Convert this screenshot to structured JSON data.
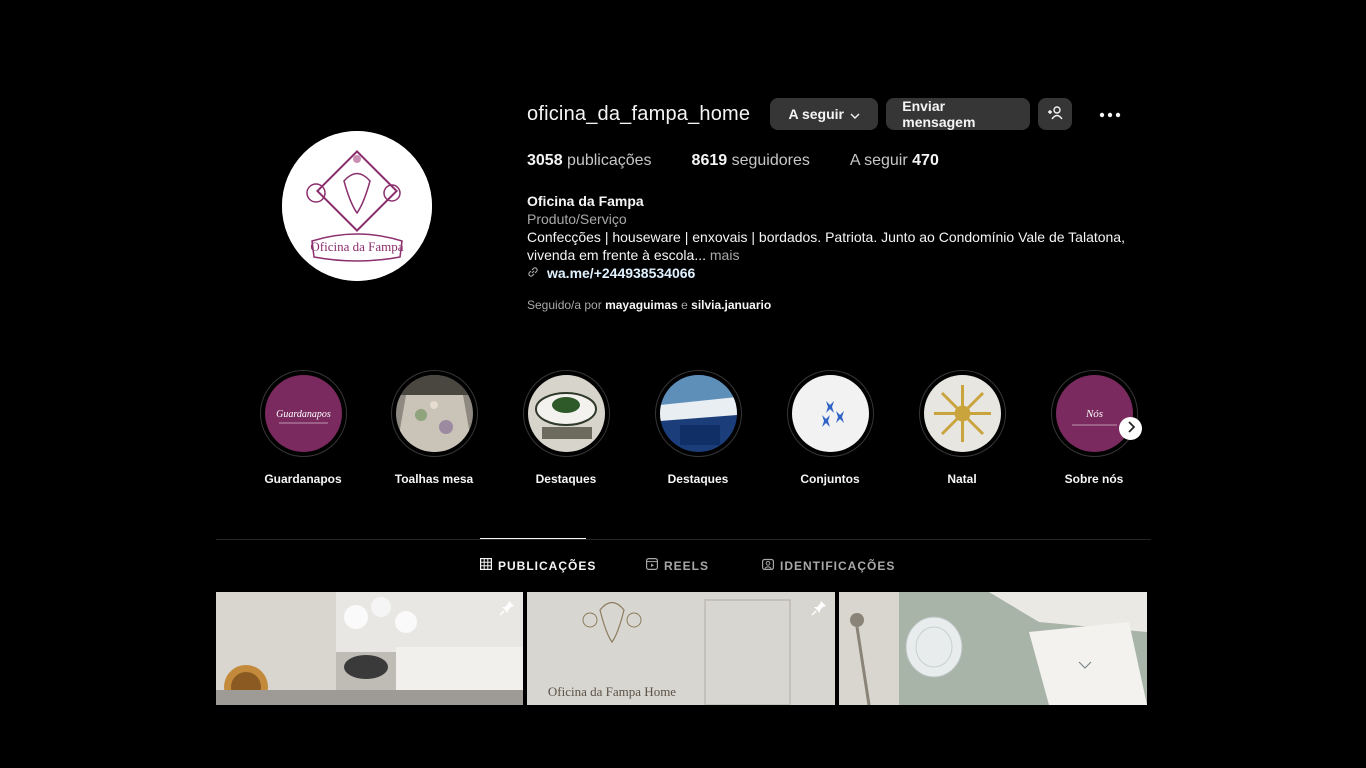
{
  "profile": {
    "username": "oficina_da_fampa_home",
    "follow_button": "A seguir",
    "message_button": "Enviar mensagem",
    "stats": {
      "posts_count": "3058",
      "posts_label": "publicações",
      "followers_count": "8619",
      "followers_label": "seguidores",
      "following_label": "A seguir",
      "following_count": "470"
    },
    "bio": {
      "name": "Oficina da Fampa",
      "category": "Produto/Serviço",
      "text": "Confecções | houseware | enxovais | bordados. Patriota. Junto ao Condomínio Vale de Talatona, vivenda em frente à escola...",
      "more": "mais",
      "link": "wa.me/+244938534066"
    },
    "followed_by": {
      "prefix": "Seguido/a por",
      "user1": "mayaguimas",
      "conj": "e",
      "user2": "silvia.januario"
    },
    "avatar_logo_text": "Oficina da Fampa"
  },
  "highlights": [
    {
      "label": "Guardanapos",
      "cover_text": "Guardanapos"
    },
    {
      "label": "Toalhas mesa"
    },
    {
      "label": "Destaques"
    },
    {
      "label": "Destaques"
    },
    {
      "label": "Conjuntos"
    },
    {
      "label": "Natal"
    },
    {
      "label": "Sobre nós",
      "cover_text": "Nós"
    }
  ],
  "tabs": [
    {
      "label": "PUBLICAÇÕES",
      "icon": "grid-icon",
      "active": true
    },
    {
      "label": "REELS",
      "icon": "reels-icon",
      "active": false
    },
    {
      "label": "IDENTIFICAÇÕES",
      "icon": "tagged-icon",
      "active": false
    }
  ],
  "posts": [
    {
      "pinned": true
    },
    {
      "pinned": true,
      "image_text": "Oficina da Fampa Home"
    },
    {
      "pinned": false
    }
  ],
  "colors": {
    "background": "#000000",
    "button": "#363636",
    "brand_purple": "#7a2a5e",
    "muted_text": "#a8a8a8"
  }
}
